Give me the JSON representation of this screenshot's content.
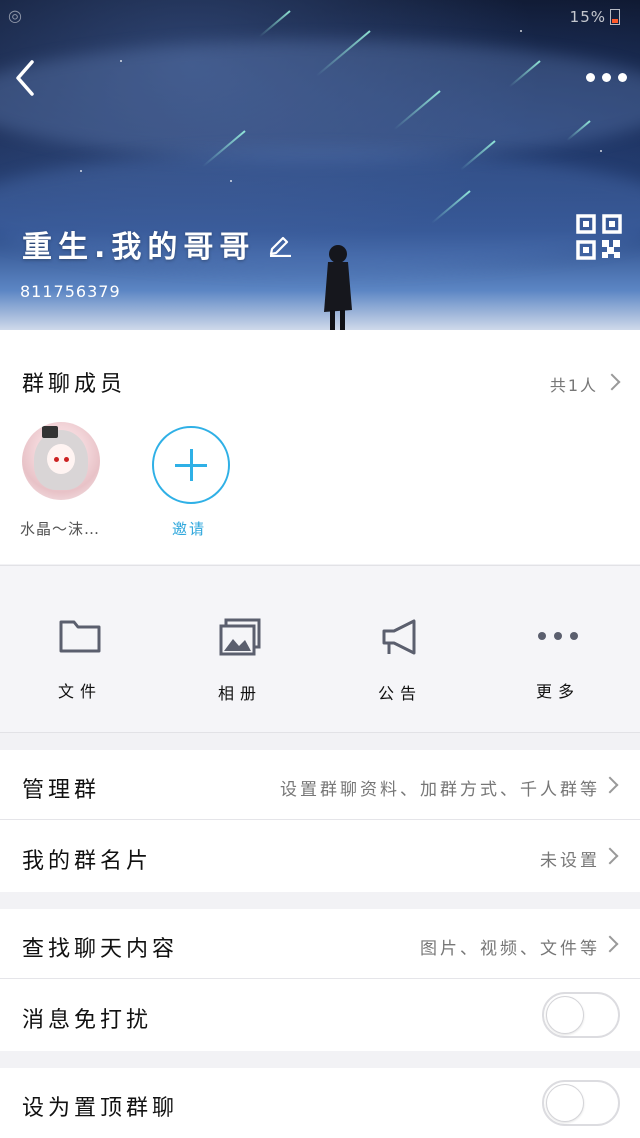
{
  "status_bar": {
    "left_icon": "circle-icon",
    "right_text": "15%"
  },
  "header": {
    "group_name": "重生.我的哥哥",
    "group_id": "811756379",
    "icons": {
      "back": "back-chevron-icon",
      "more": "more-dots-icon",
      "edit": "pencil-icon",
      "qr": "qr-code-icon"
    }
  },
  "members": {
    "title": "群聊成员",
    "count": "共1人",
    "list": [
      {
        "name": "水晶～沫…"
      }
    ],
    "invite_label": "邀请"
  },
  "functions": [
    {
      "label": "文件",
      "icon": "folder-icon"
    },
    {
      "label": "相册",
      "icon": "photo-album-icon"
    },
    {
      "label": "公告",
      "icon": "megaphone-icon"
    },
    {
      "label": "更多",
      "icon": "more-dots-icon"
    }
  ],
  "settings": {
    "manage": {
      "label": "管理群",
      "value": "设置群聊资料、加群方式、千人群等"
    },
    "card": {
      "label": "我的群名片",
      "value": "未设置"
    },
    "search": {
      "label": "查找聊天内容",
      "value": "图片、视频、文件等"
    },
    "mute": {
      "label": "消息免打扰",
      "enabled": false
    },
    "pin": {
      "label": "设为置顶群聊",
      "enabled": false
    }
  },
  "colors": {
    "accent": "#2fb0e6",
    "battery_low": "#ff5a2b"
  }
}
